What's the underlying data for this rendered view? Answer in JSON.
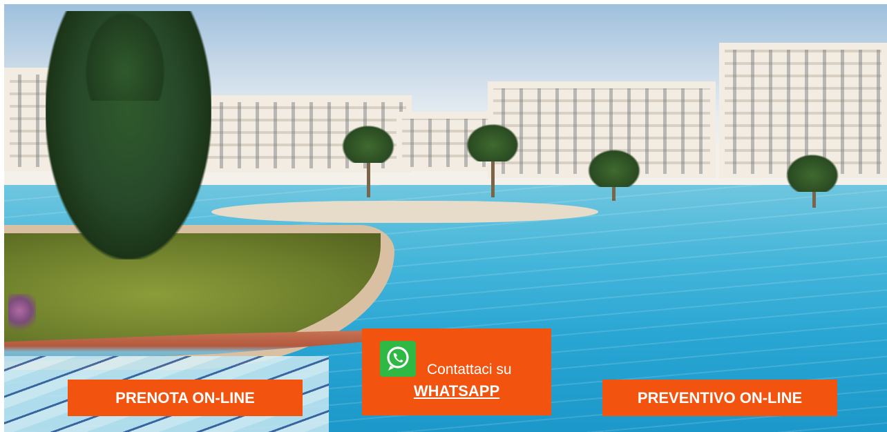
{
  "cta": {
    "book_online": "PRENOTA ON-LINE",
    "whatsapp_prefix": "Contattaci su",
    "whatsapp_link": "WHATSAPP",
    "quote_online": "PREVENTIVO ON-LINE"
  },
  "icons": {
    "whatsapp": "whatsapp-icon"
  },
  "colors": {
    "button_background": "#f2540f",
    "button_text": "#ffffff",
    "whatsapp_green": "#2fb843"
  }
}
